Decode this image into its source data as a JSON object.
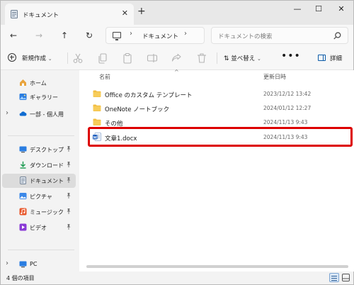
{
  "window": {
    "tab_title": "ドキュメント",
    "new_tab": "+",
    "close_tab": "✕",
    "controls": {
      "minimize": "—",
      "maximize": "☐",
      "close": "✕"
    }
  },
  "nav": {
    "back": "←",
    "forward": "→",
    "up": "↑",
    "refresh": "↻",
    "address_sep": "›",
    "location": "ドキュメント",
    "search_placeholder": "ドキュメントの検索"
  },
  "commandbar": {
    "new_label": "新規作成",
    "sort_label": "並べ替え",
    "more": "•••",
    "details_label": "詳細",
    "caret": "⌄"
  },
  "sidebar": {
    "items": [
      {
        "label": "ホーム",
        "icon": "home-icon"
      },
      {
        "label": "ギャラリー",
        "icon": "gallery-icon"
      },
      {
        "label": "一部 - 個人用",
        "icon": "onedrive-icon",
        "expander": "›"
      },
      {
        "label": "デスクトップ",
        "icon": "desktop-icon"
      },
      {
        "label": "ダウンロード",
        "icon": "download-icon"
      },
      {
        "label": "ドキュメント",
        "icon": "documents-icon",
        "selected": true
      },
      {
        "label": "ピクチャ",
        "icon": "pictures-icon"
      },
      {
        "label": "ミュージック",
        "icon": "music-icon"
      },
      {
        "label": "ビデオ",
        "icon": "video-icon"
      },
      {
        "label": "PC",
        "icon": "pc-icon",
        "expander": "›"
      }
    ]
  },
  "list": {
    "headers": {
      "name": "名前",
      "modified": "更新日時"
    },
    "sort_indicator": "^",
    "rows": [
      {
        "name": "Office のカスタム テンプレート",
        "modified": "2023/12/12 13:42",
        "icon": "folder-icon"
      },
      {
        "name": "OneNote ノートブック",
        "modified": "2024/01/12 12:27",
        "icon": "folder-icon"
      },
      {
        "name": "その他",
        "modified": "2024/11/13 9:43",
        "icon": "folder-icon"
      },
      {
        "name": "文章1.docx",
        "modified": "2024/11/13 9:43",
        "icon": "word-document-icon",
        "highlighted": true
      }
    ]
  },
  "status": {
    "count": "4 個の項目"
  },
  "colors": {
    "accent": "#0a5aa8",
    "folder": "#f2be42",
    "highlight": "#dd0000",
    "word": "#185abd"
  }
}
